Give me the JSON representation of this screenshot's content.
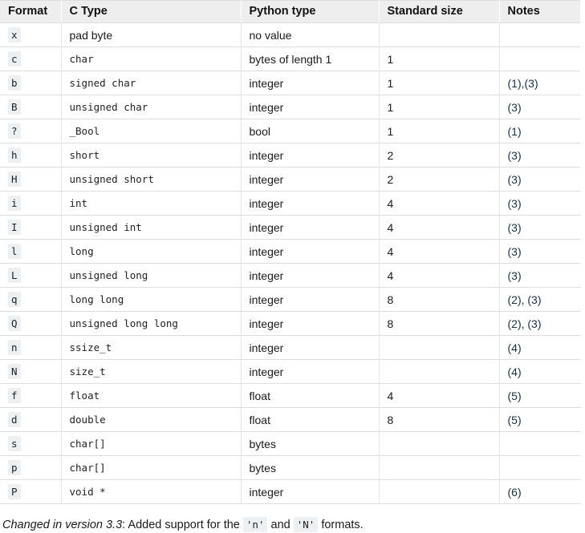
{
  "table": {
    "headers": [
      {
        "label": "Format",
        "name": "column-header-format"
      },
      {
        "label": "C Type",
        "name": "column-header-c-type"
      },
      {
        "label": "Python type",
        "name": "column-header-python-type"
      },
      {
        "label": "Standard size",
        "name": "column-header-standard-size"
      },
      {
        "label": "Notes",
        "name": "column-header-notes"
      }
    ],
    "rows": [
      {
        "format": "x",
        "ctype": "pad byte",
        "ctype_code": false,
        "pytype": "no value",
        "size": "",
        "notes": ""
      },
      {
        "format": "c",
        "ctype": "char",
        "ctype_code": true,
        "pytype": "bytes of length 1",
        "size": "1",
        "notes": ""
      },
      {
        "format": "b",
        "ctype": "signed char",
        "ctype_code": true,
        "pytype": "integer",
        "size": "1",
        "notes": "(1),(3)"
      },
      {
        "format": "B",
        "ctype": "unsigned char",
        "ctype_code": true,
        "pytype": "integer",
        "size": "1",
        "notes": "(3)"
      },
      {
        "format": "?",
        "ctype": "_Bool",
        "ctype_code": true,
        "pytype": "bool",
        "size": "1",
        "notes": "(1)"
      },
      {
        "format": "h",
        "ctype": "short",
        "ctype_code": true,
        "pytype": "integer",
        "size": "2",
        "notes": "(3)"
      },
      {
        "format": "H",
        "ctype": "unsigned short",
        "ctype_code": true,
        "pytype": "integer",
        "size": "2",
        "notes": "(3)"
      },
      {
        "format": "i",
        "ctype": "int",
        "ctype_code": true,
        "pytype": "integer",
        "size": "4",
        "notes": "(3)"
      },
      {
        "format": "I",
        "ctype": "unsigned int",
        "ctype_code": true,
        "pytype": "integer",
        "size": "4",
        "notes": "(3)"
      },
      {
        "format": "l",
        "ctype": "long",
        "ctype_code": true,
        "pytype": "integer",
        "size": "4",
        "notes": "(3)"
      },
      {
        "format": "L",
        "ctype": "unsigned long",
        "ctype_code": true,
        "pytype": "integer",
        "size": "4",
        "notes": "(3)"
      },
      {
        "format": "q",
        "ctype": "long long",
        "ctype_code": true,
        "pytype": "integer",
        "size": "8",
        "notes": "(2), (3)"
      },
      {
        "format": "Q",
        "ctype": "unsigned long long",
        "ctype_code": true,
        "pytype": "integer",
        "size": "8",
        "notes": "(2), (3)"
      },
      {
        "format": "n",
        "ctype": "ssize_t",
        "ctype_code": true,
        "pytype": "integer",
        "size": "",
        "notes": "(4)"
      },
      {
        "format": "N",
        "ctype": "size_t",
        "ctype_code": true,
        "pytype": "integer",
        "size": "",
        "notes": "(4)"
      },
      {
        "format": "f",
        "ctype": "float",
        "ctype_code": true,
        "pytype": "float",
        "size": "4",
        "notes": "(5)"
      },
      {
        "format": "d",
        "ctype": "double",
        "ctype_code": true,
        "pytype": "float",
        "size": "8",
        "notes": "(5)"
      },
      {
        "format": "s",
        "ctype": "char[]",
        "ctype_code": true,
        "pytype": "bytes",
        "size": "",
        "notes": ""
      },
      {
        "format": "p",
        "ctype": "char[]",
        "ctype_code": true,
        "pytype": "bytes",
        "size": "",
        "notes": ""
      },
      {
        "format": "P",
        "ctype": "void *",
        "ctype_code": true,
        "pytype": "integer",
        "size": "",
        "notes": "(6)"
      }
    ]
  },
  "version_note": {
    "label": "Changed in version 3.3",
    "separator": ": ",
    "text_before": "Added support for the ",
    "code_1": "'n'",
    "text_middle": " and ",
    "code_2": "'N'",
    "text_after": " formats."
  },
  "colors": {
    "header_bg": "#eeeeee",
    "border": "#dddddd",
    "code_chip_bg": "#ecf0f3",
    "link": "#15314b",
    "text": "#1a1a1a"
  }
}
